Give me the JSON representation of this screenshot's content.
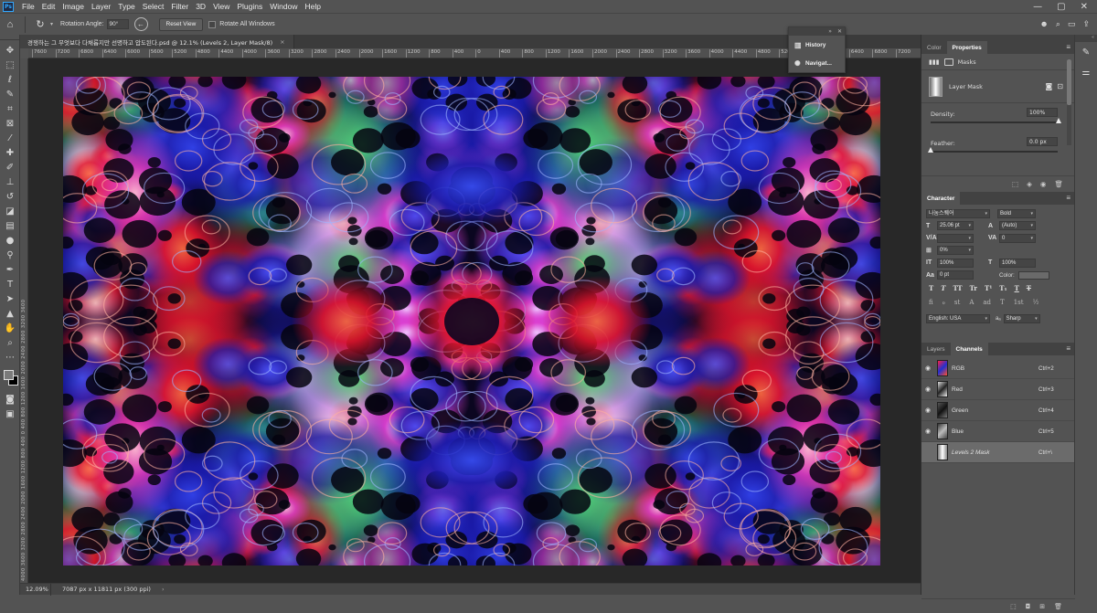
{
  "app": {
    "logo_text": "Ps"
  },
  "menu": {
    "items": [
      "File",
      "Edit",
      "Image",
      "Layer",
      "Type",
      "Select",
      "Filter",
      "3D",
      "View",
      "Plugins",
      "Window",
      "Help"
    ],
    "window_controls": [
      "—",
      "▢",
      "✕"
    ]
  },
  "options_bar": {
    "rotation_label": "Rotation Angle:",
    "rotation_value": "90°",
    "reset_view_label": "Reset View",
    "rotate_all_label": "Rotate All Windows"
  },
  "document": {
    "tab_title": "경쟁하는 그 무엇보다 다채롭지만 선명하고 압도된다.psd @ 12.1% (Levels 2, Layer Mask/8)",
    "close_symbol": "×"
  },
  "ruler": {
    "top_ticks": [
      "7600",
      "7200",
      "6800",
      "6400",
      "6000",
      "5600",
      "5200",
      "4800",
      "4400",
      "4000",
      "3600",
      "3200",
      "2800",
      "2400",
      "2000",
      "1600",
      "1200",
      "800",
      "400",
      "0",
      "400",
      "800",
      "1200",
      "1600",
      "2000",
      "2400",
      "2800",
      "3200",
      "3600",
      "4000",
      "4400",
      "4800",
      "5200",
      "5600",
      "6000",
      "6400",
      "6800",
      "7200"
    ],
    "left_text": "4000 3600 3200 2800 2400 2000 1600 1200 800 400 0 400 800 1200 1600 2000 2400 2800 3200 3600"
  },
  "status": {
    "zoom": "12.09%",
    "doc_info": "7087 px x 11811 px (300 ppi)",
    "arrow": "›"
  },
  "floating_panel": {
    "history_label": "History",
    "navigator_label": "Navigat..."
  },
  "properties_panel": {
    "tabs": [
      "Color",
      "Properties"
    ],
    "masks_label": "Masks",
    "layer_mask_label": "Layer Mask",
    "density_label": "Density:",
    "density_value": "100%",
    "density_level": 1.0,
    "feather_label": "Feather:",
    "feather_value": "0.0 px",
    "feather_level": 0.0
  },
  "character_panel": {
    "tab": "Character",
    "font_family": "나눔스퀘어",
    "font_style": "Bold",
    "font_size": "25.06 pt",
    "leading": "(Auto)",
    "kerning": "",
    "tracking": "0",
    "tsume": "0%",
    "vertical_scale": "100%",
    "horizontal_scale": "100%",
    "baseline_shift": "0 pt",
    "color_label": "Color:",
    "style_buttons": [
      "T",
      "T",
      "TT",
      "Tr",
      "T¹",
      "T₁",
      "T",
      "T"
    ],
    "opentype_buttons": [
      "fi",
      "ℴ",
      "st",
      "A",
      "ad",
      "T",
      "1st",
      "½"
    ],
    "language": "English: USA",
    "antialias": "Sharp"
  },
  "channels_panel": {
    "tabs": [
      "Layers",
      "Channels"
    ],
    "channels": [
      {
        "name": "RGB",
        "shortcut": "Ctrl+2",
        "visible": true,
        "selected": false
      },
      {
        "name": "Red",
        "shortcut": "Ctrl+3",
        "visible": true,
        "selected": false
      },
      {
        "name": "Green",
        "shortcut": "Ctrl+4",
        "visible": true,
        "selected": false
      },
      {
        "name": "Blue",
        "shortcut": "Ctrl+5",
        "visible": true,
        "selected": false
      },
      {
        "name": "Levels 2 Mask",
        "shortcut": "Ctrl+\\",
        "visible": false,
        "selected": true
      }
    ]
  },
  "colors": {
    "ui_bg": "#535353",
    "panel_dark": "#424242",
    "accent_blue": "#31a8ff",
    "selected_row": "#6b6b6b"
  }
}
